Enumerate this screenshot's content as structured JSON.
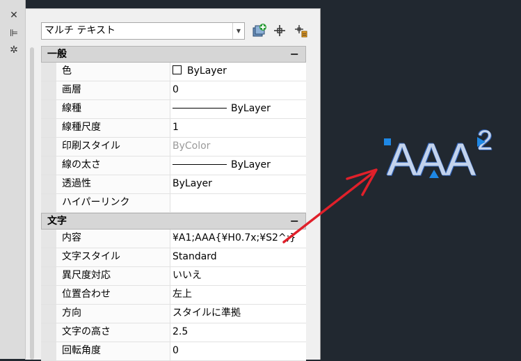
{
  "toolbar": {
    "object_type": "マルチ テキスト",
    "quick_select_icon": "quick-select-icon",
    "select_objects_icon": "select-objects-icon",
    "toggle_pickadd_icon": "toggle-pickadd-icon"
  },
  "side_strip": {
    "close_icon": "close-icon",
    "autohide_icon": "autohide-icon",
    "properties_icon": "properties-icon"
  },
  "sections": [
    {
      "title": "一般",
      "toggle": "−",
      "rows": [
        {
          "name": "色",
          "value": "ByLayer",
          "kind": "color"
        },
        {
          "name": "画層",
          "value": "0"
        },
        {
          "name": "線種",
          "value": "ByLayer",
          "kind": "linetype"
        },
        {
          "name": "線種尺度",
          "value": "1"
        },
        {
          "name": "印刷スタイル",
          "value": "ByColor",
          "kind": "gray"
        },
        {
          "name": "線の太さ",
          "value": "ByLayer",
          "kind": "linetype"
        },
        {
          "name": "透過性",
          "value": "ByLayer"
        },
        {
          "name": "ハイパーリンク",
          "value": ""
        }
      ]
    },
    {
      "title": "文字",
      "toggle": "−",
      "rows": [
        {
          "name": "内容",
          "value": "¥A1;AAA{¥H0.7x;¥S2^;}"
        },
        {
          "name": "文字スタイル",
          "value": "Standard"
        },
        {
          "name": "異尺度対応",
          "value": "いいえ"
        },
        {
          "name": "位置合わせ",
          "value": "左上"
        },
        {
          "name": "方向",
          "value": "スタイルに準拠"
        },
        {
          "name": "文字の高さ",
          "value": "2.5"
        },
        {
          "name": "回転角度",
          "value": "0"
        }
      ]
    }
  ],
  "canvas": {
    "text": "AAA",
    "superscript": "2",
    "background": "#212830",
    "annotation_arrow_color": "#e0202a",
    "grip_color": "#1e88e5"
  }
}
